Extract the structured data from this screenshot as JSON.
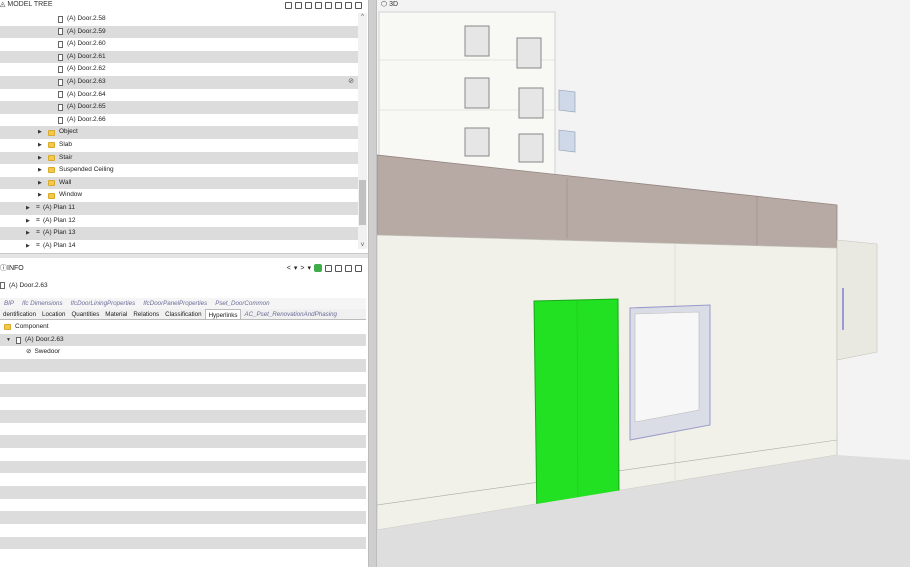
{
  "model_tree": {
    "title": "MODEL TREE",
    "rows": [
      {
        "label": "(A) Door.2.58",
        "kind": "door",
        "indent": 58,
        "alt": false
      },
      {
        "label": "(A) Door.2.59",
        "kind": "door",
        "indent": 58,
        "alt": true
      },
      {
        "label": "(A) Door.2.60",
        "kind": "door",
        "indent": 58,
        "alt": false
      },
      {
        "label": "(A) Door.2.61",
        "kind": "door",
        "indent": 58,
        "alt": true
      },
      {
        "label": "(A) Door.2.62",
        "kind": "door",
        "indent": 58,
        "alt": false
      },
      {
        "label": "(A) Door.2.63",
        "kind": "door",
        "indent": 58,
        "alt": true,
        "clip": true
      },
      {
        "label": "(A) Door.2.64",
        "kind": "door",
        "indent": 58,
        "alt": false
      },
      {
        "label": "(A) Door.2.65",
        "kind": "door",
        "indent": 58,
        "alt": true
      },
      {
        "label": "(A) Door.2.66",
        "kind": "door",
        "indent": 58,
        "alt": false
      },
      {
        "label": "Object",
        "kind": "folder",
        "indent": 38,
        "alt": true
      },
      {
        "label": "Slab",
        "kind": "folder",
        "indent": 38,
        "alt": false
      },
      {
        "label": "Stair",
        "kind": "folder",
        "indent": 38,
        "alt": true
      },
      {
        "label": "Suspended Ceiling",
        "kind": "folder",
        "indent": 38,
        "alt": false
      },
      {
        "label": "Wall",
        "kind": "folder",
        "indent": 38,
        "alt": true
      },
      {
        "label": "Window",
        "kind": "folder",
        "indent": 38,
        "alt": false
      },
      {
        "label": "(A) Plan 11",
        "kind": "plan",
        "indent": 26,
        "alt": true
      },
      {
        "label": "(A) Plan 12",
        "kind": "plan",
        "indent": 26,
        "alt": false
      },
      {
        "label": "(A) Plan 13",
        "kind": "plan",
        "indent": 26,
        "alt": true
      },
      {
        "label": "(A) Plan 14",
        "kind": "plan",
        "indent": 26,
        "alt": false
      }
    ]
  },
  "info": {
    "title": "INFO",
    "selected": "(A) Door.2.63",
    "tabs_top": [
      "BIP",
      "Ifc Dimensions",
      "IfcDoorLiningProperties",
      "IfcDoorPanelProperties",
      "Pset_DoorCommon"
    ],
    "tabs_bottom": [
      "dentification",
      "Location",
      "Quantities",
      "Material",
      "Relations",
      "Classification",
      "Hyperlinks",
      "AC_Pset_RenovationAndPhasing"
    ],
    "active_tab": "Hyperlinks",
    "rows": [
      {
        "label": "Component",
        "kind": "folder",
        "indent": 4
      },
      {
        "label": "(A) Door.2.63",
        "kind": "door-expanded",
        "indent": 6
      },
      {
        "label": "Swedoor",
        "kind": "link",
        "indent": 26
      }
    ]
  },
  "view3d": {
    "title": "3D",
    "highlight_color": "#22e022"
  }
}
